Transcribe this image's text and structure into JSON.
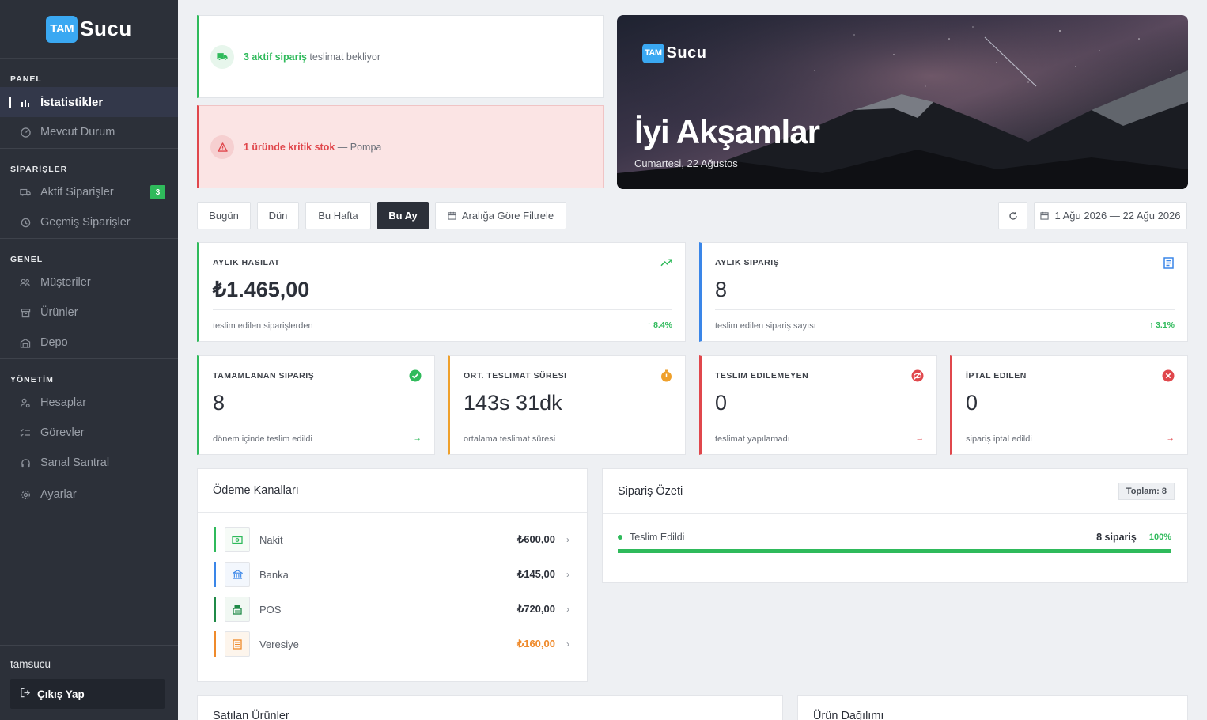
{
  "brand": {
    "badge": "TAM",
    "name": "Sucu"
  },
  "sidebar": {
    "sections": [
      {
        "title": "PANEL",
        "items": [
          {
            "label": "İstatistikler",
            "active": true
          },
          {
            "label": "Mevcut Durum"
          }
        ]
      },
      {
        "title": "SİPARİŞLER",
        "items": [
          {
            "label": "Aktif Siparişler",
            "badge": "3"
          },
          {
            "label": "Geçmiş Siparişler"
          }
        ]
      },
      {
        "title": "GENEL",
        "items": [
          {
            "label": "Müşteriler"
          },
          {
            "label": "Ürünler"
          },
          {
            "label": "Depo"
          }
        ]
      },
      {
        "title": "YÖNETİM",
        "items": [
          {
            "label": "Hesaplar"
          },
          {
            "label": "Görevler"
          },
          {
            "label": "Sanal Santral"
          }
        ]
      }
    ],
    "settings_label": "Ayarlar",
    "username": "tamsucu",
    "logout_label": "Çıkış Yap"
  },
  "alerts": {
    "delivery": {
      "bold": "3 aktif sipariş",
      "rest": " teslimat bekliyor"
    },
    "stock": {
      "bold": "1 üründe kritik stok",
      "rest": " — Pompa"
    }
  },
  "hero": {
    "greeting": "İyi Akşamlar",
    "date": "Cumartesi, 22 Ağustos"
  },
  "filters": {
    "today": "Bugün",
    "yesterday": "Dün",
    "this_week": "Bu Hafta",
    "this_month": "Bu Ay",
    "range": "Aralığa Göre Filtrele",
    "date_range": "1 Ağu 2026 — 22 Ağu 2026"
  },
  "stats": {
    "monthly_revenue": {
      "label": "AYLIK HASILAT",
      "value": "₺1.465,00",
      "foot": "teslim edilen siparişlerden",
      "trend": "8.4%"
    },
    "monthly_orders": {
      "label": "AYLIK SIPARIŞ",
      "value": "8",
      "foot": "teslim edilen sipariş sayısı",
      "trend": "3.1%"
    },
    "completed": {
      "label": "TAMAMLANAN SIPARIŞ",
      "value": "8",
      "foot": "dönem içinde teslim edildi"
    },
    "avg_delivery": {
      "label": "ORT. TESLIMAT SÜRESI",
      "value": "143s 31dk",
      "foot": "ortalama teslimat süresi"
    },
    "undelivered": {
      "label": "TESLIM EDILEMEYEN",
      "value": "0",
      "foot": "teslimat yapılamadı"
    },
    "cancelled": {
      "label": "İPTAL EDILEN",
      "value": "0",
      "foot": "sipariş iptal edildi"
    }
  },
  "payments": {
    "title": "Ödeme Kanalları",
    "rows": [
      {
        "label": "Nakit",
        "amount": "₺600,00",
        "color": "#2fba5b"
      },
      {
        "label": "Banka",
        "amount": "₺145,00",
        "color": "#3a86e8"
      },
      {
        "label": "POS",
        "amount": "₺720,00",
        "color": "#1f8a47"
      },
      {
        "label": "Veresiye",
        "amount": "₺160,00",
        "color": "#ef8a2b"
      }
    ]
  },
  "order_summary": {
    "title": "Sipariş Özeti",
    "total": "Toplam: 8",
    "row": {
      "label": "Teslim Edildi",
      "count": "8 sipariş",
      "percent": "100%",
      "fill": 1.0
    }
  },
  "bottom": {
    "sold_products": "Satılan Ürünler",
    "product_distribution": "Ürün Dağılımı"
  },
  "colors": {
    "green": "#2fba5b",
    "blue": "#3a86e8",
    "orange": "#efa02b",
    "red": "#e0474c",
    "sidebar": "#2c3039"
  }
}
